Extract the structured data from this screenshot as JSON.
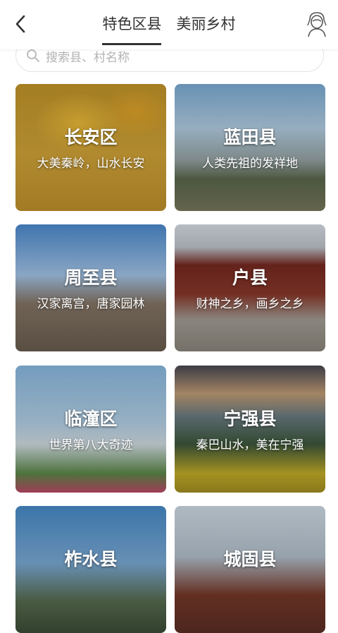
{
  "header": {
    "tabs": [
      {
        "label": "特色区县",
        "active": true
      },
      {
        "label": "美丽乡村",
        "active": false
      }
    ]
  },
  "search": {
    "placeholder": "搜索县、村名称"
  },
  "cards": [
    {
      "title": "长安区",
      "subtitle": "大美秦岭，山水长安"
    },
    {
      "title": "蓝田县",
      "subtitle": "人类先祖的发祥地"
    },
    {
      "title": "周至县",
      "subtitle": "汉家离宫，唐家园林"
    },
    {
      "title": "户县",
      "subtitle": "财神之乡，画乡之乡"
    },
    {
      "title": "临潼区",
      "subtitle": "世界第八大奇迹"
    },
    {
      "title": "宁强县",
      "subtitle": "秦巴山水，美在宁强"
    },
    {
      "title": "柞水县",
      "subtitle": ""
    },
    {
      "title": "城固县",
      "subtitle": ""
    }
  ],
  "colors": {
    "text_primary": "#333333",
    "card_text": "#ffffff"
  },
  "icons": {
    "back": "chevron-left-icon",
    "avatar": "user-avatar-icon",
    "search": "search-icon"
  }
}
